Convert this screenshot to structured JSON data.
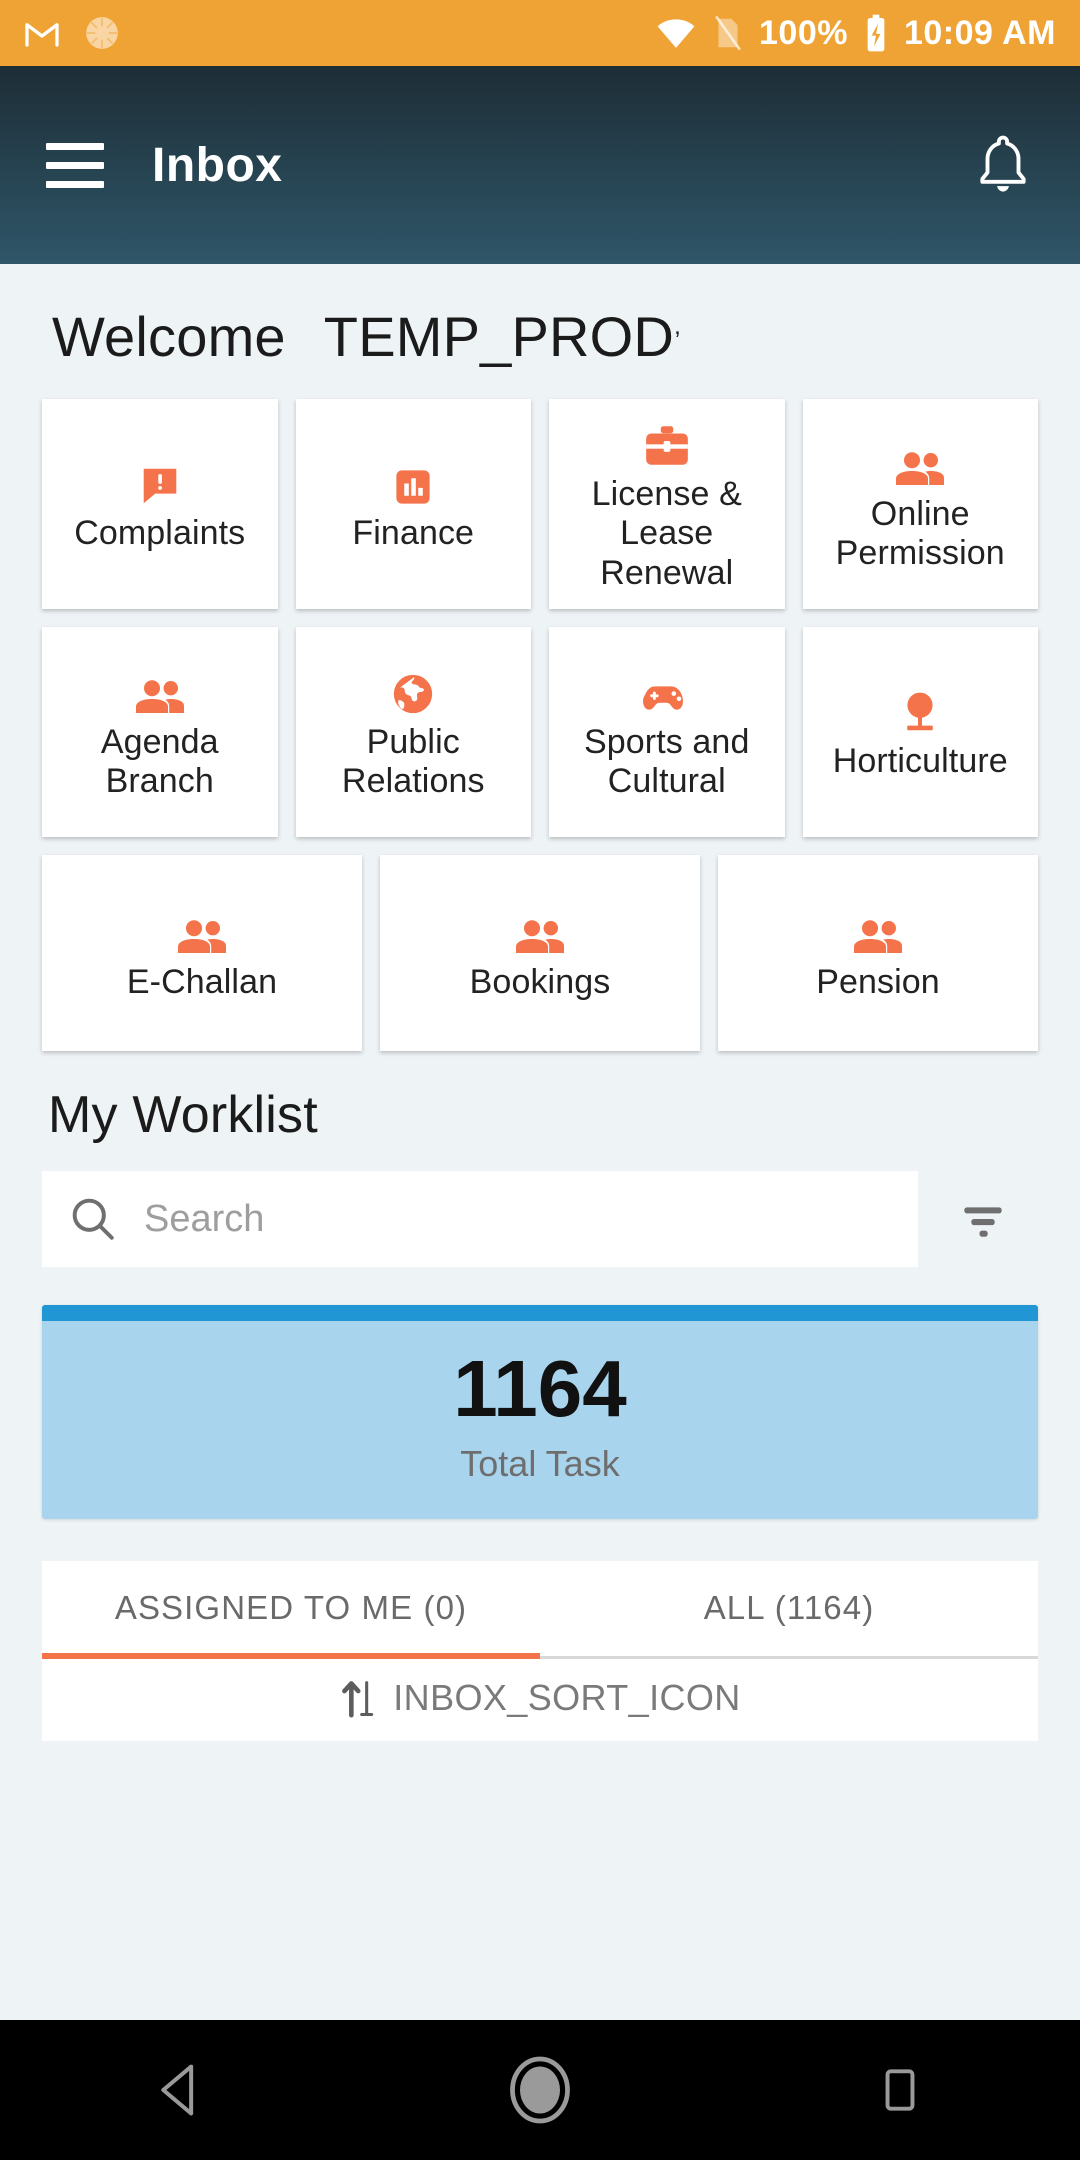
{
  "status_bar": {
    "icons": [
      "gmail-icon",
      "sun-circle-icon",
      "wifi-icon",
      "no-sim-icon"
    ],
    "battery_percent": "100%",
    "time": "10:09 AM",
    "background": "#efa334"
  },
  "app_bar": {
    "menu_icon": "hamburger-menu-icon",
    "title": "Inbox",
    "notification_icon": "bell-icon"
  },
  "welcome": {
    "greeting": "Welcome",
    "user": "TEMP_PROD",
    "tail": ","
  },
  "tiles": {
    "row1": [
      {
        "label": "Complaints",
        "icon": "comment-alert-icon"
      },
      {
        "label": "Finance",
        "icon": "chart-bar-icon"
      },
      {
        "label": "License & Lease Renewal",
        "icon": "briefcase-icon"
      },
      {
        "label": "Online Permission",
        "icon": "people-icon"
      }
    ],
    "row2": [
      {
        "label": "Agenda Branch",
        "icon": "people-icon"
      },
      {
        "label": "Public Relations",
        "icon": "globe-icon"
      },
      {
        "label": "Sports and Cultural",
        "icon": "gamepad-icon"
      },
      {
        "label": "Horticulture",
        "icon": "tree-icon"
      }
    ],
    "row3": [
      {
        "label": "E-Challan",
        "icon": "people-icon"
      },
      {
        "label": "Bookings",
        "icon": "people-icon"
      },
      {
        "label": "Pension",
        "icon": "people-icon"
      }
    ],
    "accent_color": "#f4734a"
  },
  "worklist": {
    "title": "My Worklist",
    "search_placeholder": "Search",
    "search_value": "",
    "search_icon": "search-icon",
    "filter_icon": "filter-icon",
    "total_card": {
      "count": "1164",
      "label": "Total Task",
      "bar_color": "#2196d4",
      "background": "#a9d4ee"
    },
    "tabs": [
      {
        "label": "ASSIGNED TO ME (0)",
        "active": true
      },
      {
        "label": "ALL (1164)",
        "active": false
      }
    ],
    "sort": {
      "icon": "sort-arrows-icon",
      "label": "INBOX_SORT_ICON"
    }
  },
  "nav_bar": {
    "back": "back-triangle-icon",
    "home": "home-circle-icon",
    "recents": "recents-square-icon"
  }
}
